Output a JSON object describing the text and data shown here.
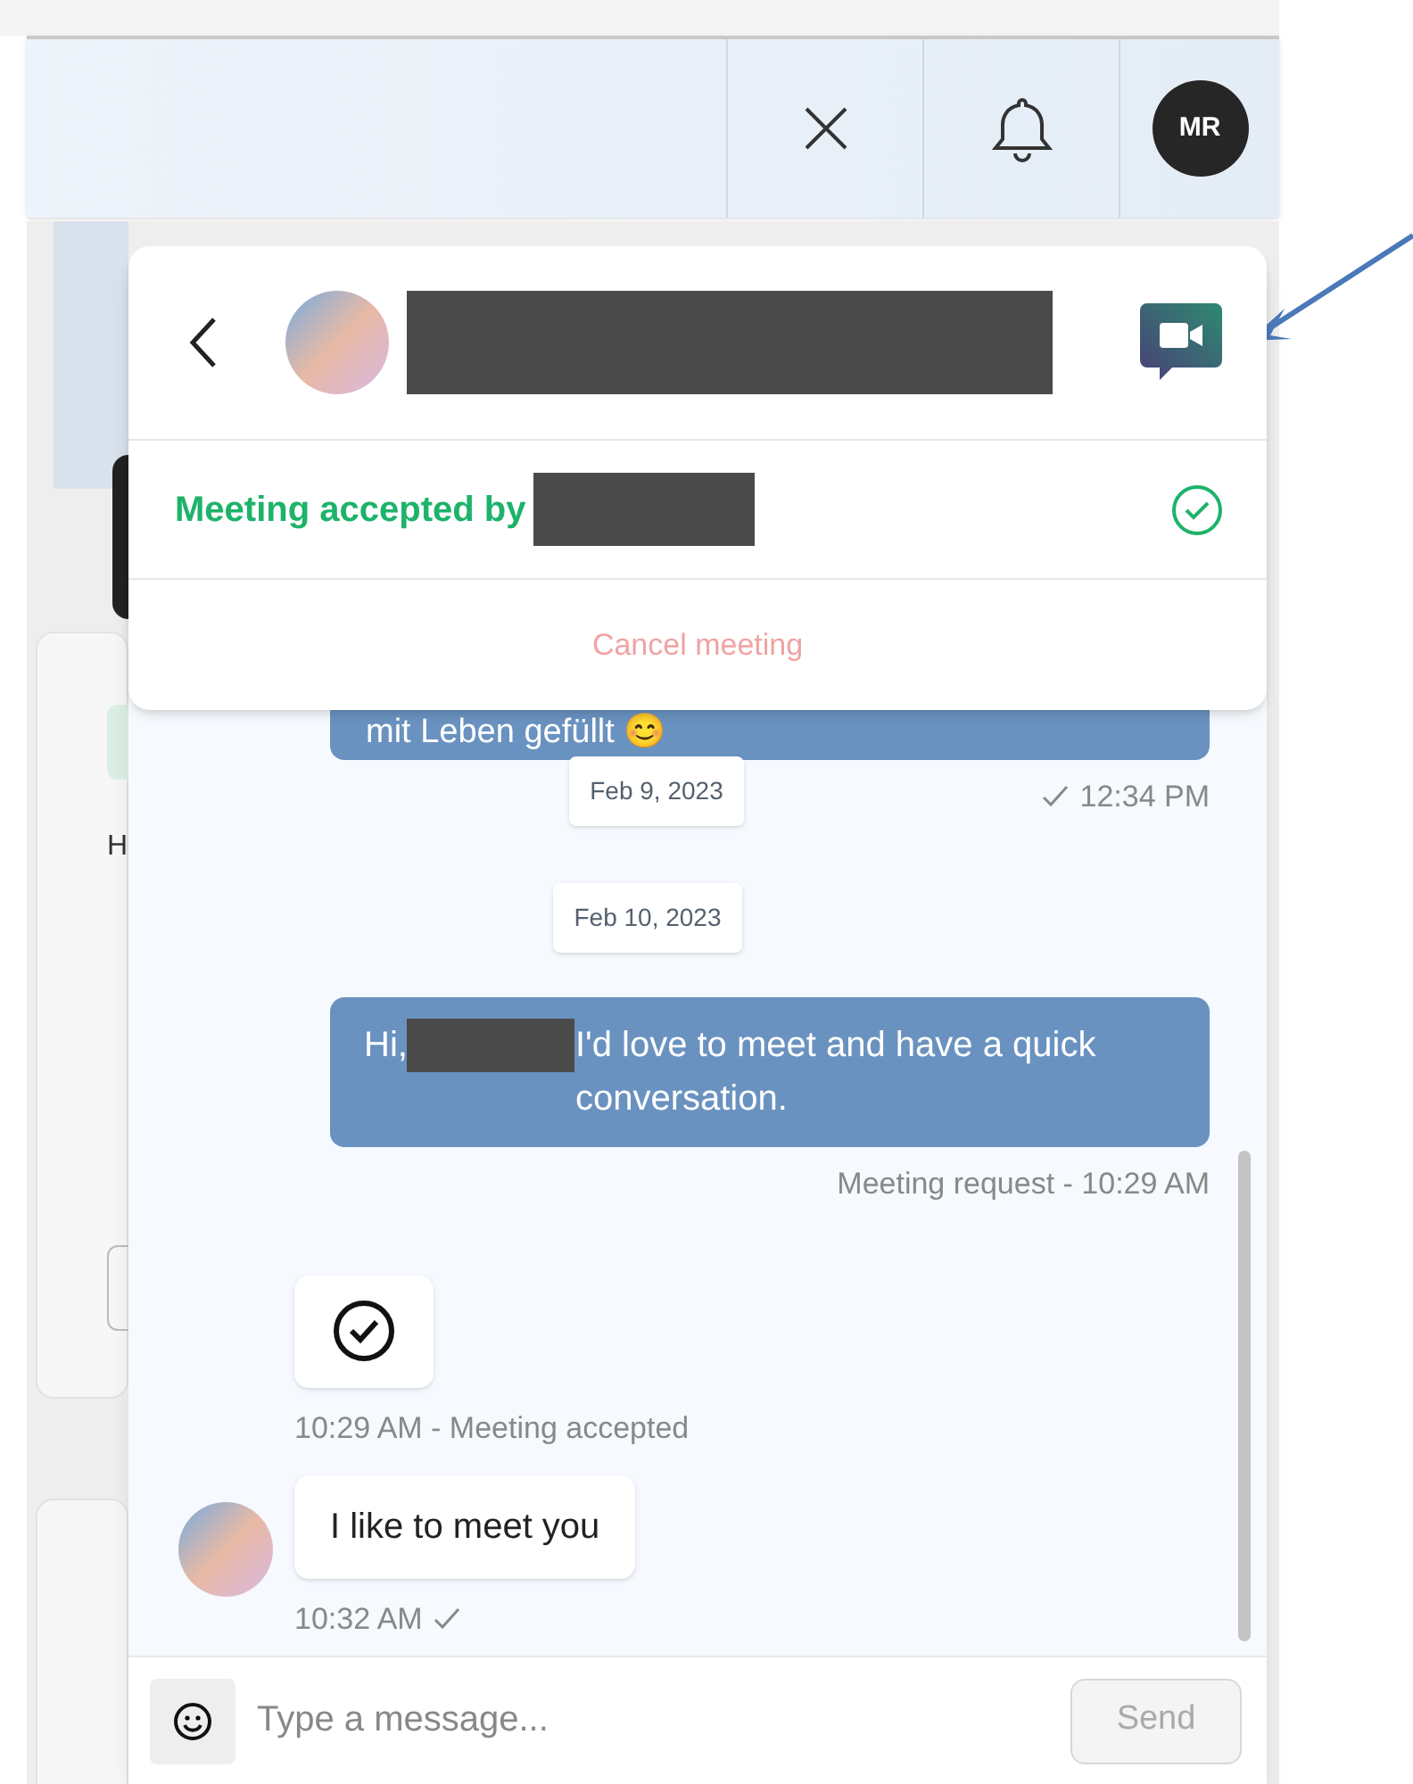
{
  "top_bar": {
    "avatar_initials": "MR"
  },
  "background": {
    "partial_text": "H"
  },
  "chat": {
    "header": {
      "name_redacted": true
    },
    "status": {
      "label": "Meeting accepted by",
      "name_redacted": true,
      "accepted": true
    },
    "cancel_label": "Cancel meeting",
    "items": [
      {
        "kind": "outgoing",
        "text": "mit Leben gefüllt 😊"
      },
      {
        "kind": "date",
        "label": "Feb 9, 2023",
        "side_meta": "12:34 PM",
        "delivered": true
      },
      {
        "kind": "date",
        "label": "Feb 10, 2023"
      },
      {
        "kind": "outgoing_redacted",
        "before": "Hi,",
        "after": "I'd love to meet and have a quick conversation.",
        "meta": "Meeting request - 10:29 AM"
      },
      {
        "kind": "accepted",
        "meta": "10:29 AM - Meeting accepted"
      },
      {
        "kind": "incoming",
        "text": "I like to meet you",
        "meta": "10:32 AM",
        "delivered": true
      }
    ],
    "composer": {
      "placeholder": "Type a message...",
      "send_label": "Send",
      "send_disabled": true
    }
  },
  "annotation": {
    "arrow": true
  }
}
